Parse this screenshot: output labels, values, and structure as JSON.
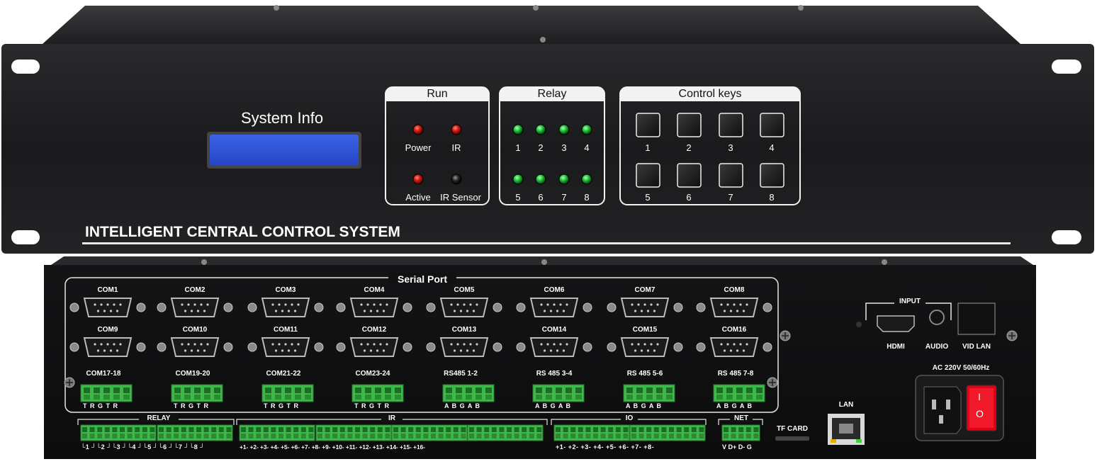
{
  "front": {
    "lcd_title": "System Info",
    "brand": "INTELLIGENT CENTRAL CONTROL SYSTEM",
    "run": {
      "title": "Run",
      "leds": [
        {
          "label": "Power",
          "state": "red"
        },
        {
          "label": "IR",
          "state": "red"
        },
        {
          "label": "Active",
          "state": "red"
        },
        {
          "label": "IR Sensor",
          "state": "off"
        }
      ]
    },
    "relay": {
      "title": "Relay",
      "leds": [
        "1",
        "2",
        "3",
        "4",
        "5",
        "6",
        "7",
        "8"
      ],
      "state": "green"
    },
    "keys": {
      "title": "Control keys",
      "labels": [
        "1",
        "2",
        "3",
        "4",
        "5",
        "6",
        "7",
        "8"
      ]
    }
  },
  "rear": {
    "serial_title": "Serial Port",
    "com_row1": [
      "COM1",
      "COM2",
      "COM3",
      "COM4",
      "COM5",
      "COM6",
      "COM7",
      "COM8"
    ],
    "com_row2": [
      "COM9",
      "COM10",
      "COM11",
      "COM12",
      "COM13",
      "COM14",
      "COM15",
      "COM16"
    ],
    "terminal_row": [
      {
        "label": "COM17-18",
        "pins": "T R G T R"
      },
      {
        "label": "COM19-20",
        "pins": "T R G T R"
      },
      {
        "label": "COM21-22",
        "pins": "T R G T R"
      },
      {
        "label": "COM23-24",
        "pins": "T R G T R"
      },
      {
        "label": "RS485  1-2",
        "pins": "A B G A B"
      },
      {
        "label": "RS 485 3-4",
        "pins": "A B G A B"
      },
      {
        "label": "RS 485 5-6",
        "pins": "A B G A B"
      },
      {
        "label": "RS 485 7-8",
        "pins": "A B G A B"
      }
    ],
    "bottom_groups": [
      {
        "title": "RELAY",
        "pins": "└1 ┘└2 ┘└3 ┘└4 ┘└5 ┘└6 ┘└7 ┘└8 ┘"
      },
      {
        "title": "IR",
        "pins": "+1- +2- +3- +4- +5- +6- +7- +8- +9- +10- +11- +12- +13- +14- +15- +16-"
      },
      {
        "title": "IO",
        "pins": "+1- +2- +3- +4- +5- +6- +7- +8-"
      },
      {
        "title": "NET",
        "pins": "V D+ D- G"
      }
    ],
    "tf_card": "TF CARD",
    "lan": "LAN",
    "input_title": "INPUT",
    "input_labels": [
      "HDMI",
      "AUDIO",
      "VID LAN"
    ],
    "power_label": "AC 220V  50/60Hz",
    "switch_on": "I",
    "switch_off": "O"
  },
  "colors": {
    "chassis": "#1b1b1d",
    "lcd": "#2f55d8",
    "terminal_green": "#3fb84a",
    "led_red": "#d01a12",
    "led_green": "#1fc43a"
  }
}
